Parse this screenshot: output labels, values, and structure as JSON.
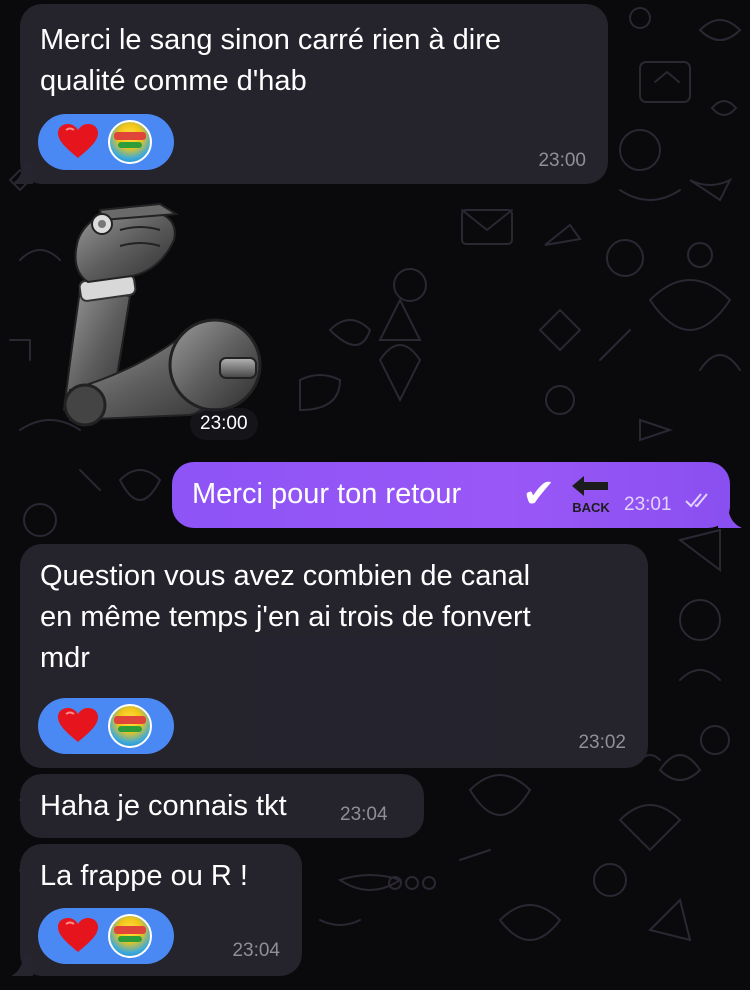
{
  "messages": [
    {
      "id": "m1",
      "direction": "incoming",
      "text": "Merci le sang sinon carré rien à dire\nqualité comme d'hab",
      "time": "23:00",
      "reaction": {
        "emoji": "heart",
        "reactor": "avatar"
      }
    },
    {
      "id": "m2",
      "direction": "incoming",
      "sticker": "mechanical-arm-emoji",
      "time": "23:00"
    },
    {
      "id": "m3",
      "direction": "outgoing",
      "text": "Merci pour ton retour",
      "emojis": [
        "check-mark-emoji",
        "back-arrow-emoji"
      ],
      "back_label": "BACK",
      "check_glyph": "✔",
      "time": "23:01",
      "status": "read"
    },
    {
      "id": "m4",
      "direction": "incoming",
      "text": "Question vous avez combien de canal\nen même temps j'en ai trois de fonvert\nmdr",
      "time": "23:02",
      "reaction": {
        "emoji": "heart",
        "reactor": "avatar"
      }
    },
    {
      "id": "m5",
      "direction": "incoming",
      "text": "Haha je connais tkt",
      "time": "23:04"
    },
    {
      "id": "m6",
      "direction": "incoming",
      "text": "La frappe ou R !",
      "time": "23:04",
      "reaction": {
        "emoji": "heart",
        "reactor": "avatar"
      }
    }
  ],
  "colors": {
    "background": "#0a0a0c",
    "incoming_bubble": "#26242e",
    "outgoing_bubble": "#9a57f7",
    "reaction_pill": "#4a89f3",
    "heart": "#e5141d",
    "time_incoming": "#8f8e99"
  }
}
